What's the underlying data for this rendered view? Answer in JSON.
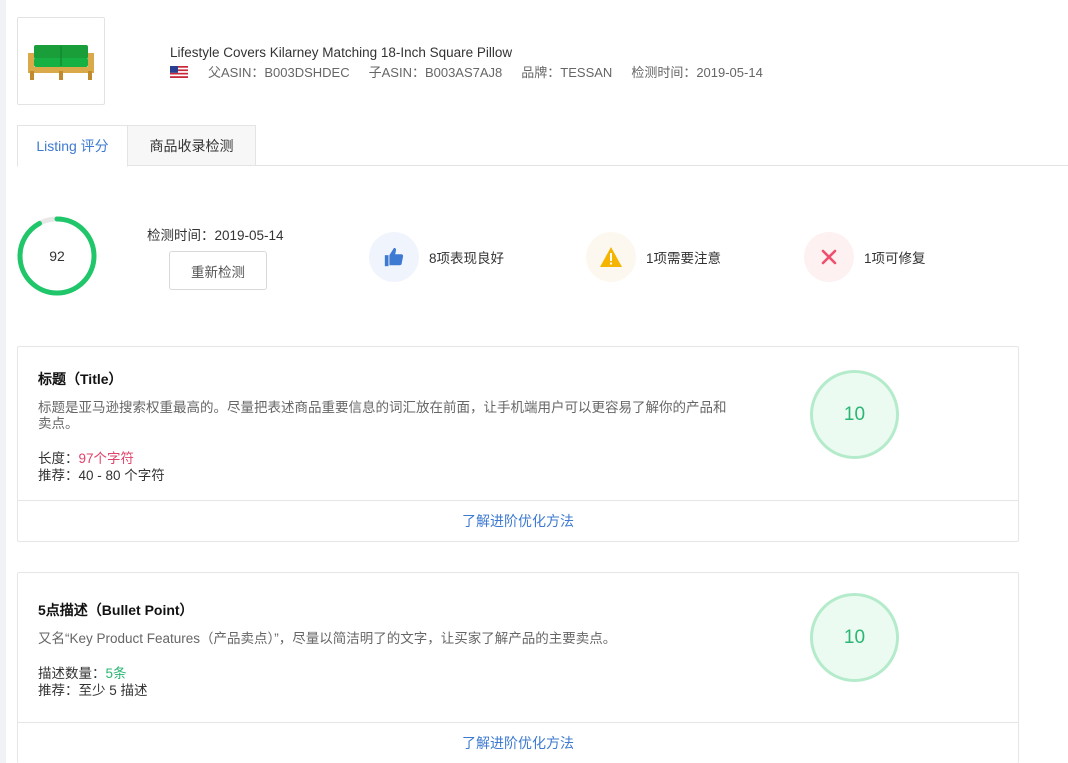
{
  "product": {
    "title": "Lifestyle Covers Kilarney Matching 18-Inch Square Pillow",
    "marketplace_flag": "us-flag",
    "parent_asin": "父ASIN：B003DSHDEC",
    "child_asin": "子ASIN：B003AS7AJ8",
    "brand": "品牌：TESSAN",
    "check_date": "检测时间：2019-05-14"
  },
  "tabs": [
    {
      "label": "Listing 评分",
      "active": true
    },
    {
      "label": "商品收录检测",
      "active": false
    }
  ],
  "summary": {
    "score": "92",
    "score_fraction": 0.92,
    "check_time": "检测时间：2019-05-14",
    "recheck_label": "重新检测",
    "good_label": "8项表现良好",
    "warn_label": "1项需要注意",
    "fix_label": "1项可修复",
    "colors": {
      "ring": "#20c66a",
      "good": "#3e7ad1",
      "warn": "#f5b400",
      "fix": "#f04f6e"
    }
  },
  "cards": [
    {
      "title": "标题（Title）",
      "desc": "标题是亚马逊搜索权重最高的。尽量把表述商品重要信息的词汇放在前面，让手机端用户可以更容易了解你的产品和卖点。",
      "line1_label": "长度：",
      "line1_value": "97个字符",
      "line2": "推荐：40 - 80 个字符",
      "score": "10",
      "footer": "了解进阶优化方法"
    },
    {
      "title": "5点描述（Bullet Point）",
      "desc": "又名“Key Product Features（产品卖点）”，尽量以简洁明了的文字，让买家了解产品的主要卖点。",
      "line1_label": "描述数量：",
      "line1_value": "5条",
      "line2": "推荐：至少 5 描述",
      "score": "10",
      "footer": "了解进阶优化方法"
    }
  ]
}
